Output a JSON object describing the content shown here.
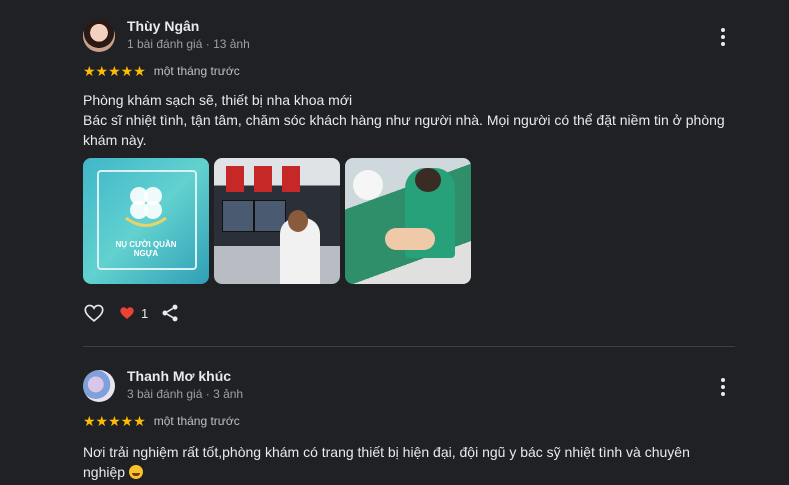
{
  "reviews": [
    {
      "name": "Thùy Ngân",
      "meta": "1 bài đánh giá · 13 ảnh",
      "stars": "★★★★★",
      "time": "một tháng trước",
      "lines": [
        "Phòng khám sạch sẽ, thiết bị nha khoa mới",
        "Bác sĩ nhiệt tình, tận tâm, chăm sóc khách hàng như người nhà. Mọi người có thể đặt niềm tin ở phòng khám này."
      ],
      "photo_caption": "NỤ CƯỜI QUẦN NGỰA",
      "like_count": "1"
    },
    {
      "name": "Thanh Mơ khúc",
      "meta": "3 bài đánh giá · 3 ảnh",
      "stars": "★★★★★",
      "time": "một tháng trước",
      "lines": [
        "Nơi trải nghiệm rất tốt,phòng khám có trang thiết bị hiện đại, đội ngũ y bác sỹ nhiệt tình và chuyên nghiệp"
      ]
    }
  ],
  "colors": {
    "background": "#202124",
    "star": "#fbbc04",
    "heart_filled": "#ea4335"
  },
  "icons": {
    "more": "more-vert-icon",
    "like": "heart-outline-icon",
    "liked": "heart-filled-icon",
    "share": "share-icon"
  }
}
